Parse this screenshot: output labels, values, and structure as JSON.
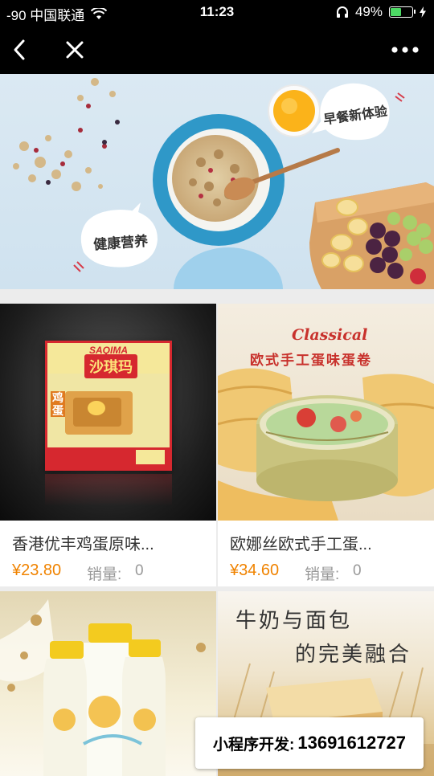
{
  "status_bar": {
    "carrier": "-90 中国联通",
    "time": "11:23",
    "battery": "49%",
    "battery_level": 0.49,
    "wifi_icon": "wifi-icon",
    "headphones_icon": "headphones-icon"
  },
  "nav": {
    "back_icon": "back-chevron-icon",
    "close_icon": "close-icon",
    "more_icon": "more-dots-icon"
  },
  "banner": {
    "bubble_breakfast": "早餐新体验",
    "bubble_health": "健康营养"
  },
  "products": [
    {
      "name": "香港优丰鸡蛋原味...",
      "price": "¥23.80",
      "sales_label": "销量:",
      "sales_value": "0",
      "package_brand": "SAQIMA",
      "package_title": "沙琪玛",
      "package_badge": "鸡蛋"
    },
    {
      "name": "欧娜丝欧式手工蛋...",
      "price": "¥34.60",
      "sales_label": "销量:",
      "sales_value": "0",
      "image_heading": "Classical",
      "image_subheading": "欧式手工蛋味蛋卷"
    },
    {
      "image_title": "牛奶与面包"
    },
    {
      "image_heading": "牛奶与面包",
      "image_subheading": "的完美融合"
    }
  ],
  "promo": {
    "label": "小程序开发:",
    "phone": "13691612727"
  },
  "colors": {
    "price": "#f08300",
    "muted": "#999999",
    "status_bg": "#000000"
  }
}
